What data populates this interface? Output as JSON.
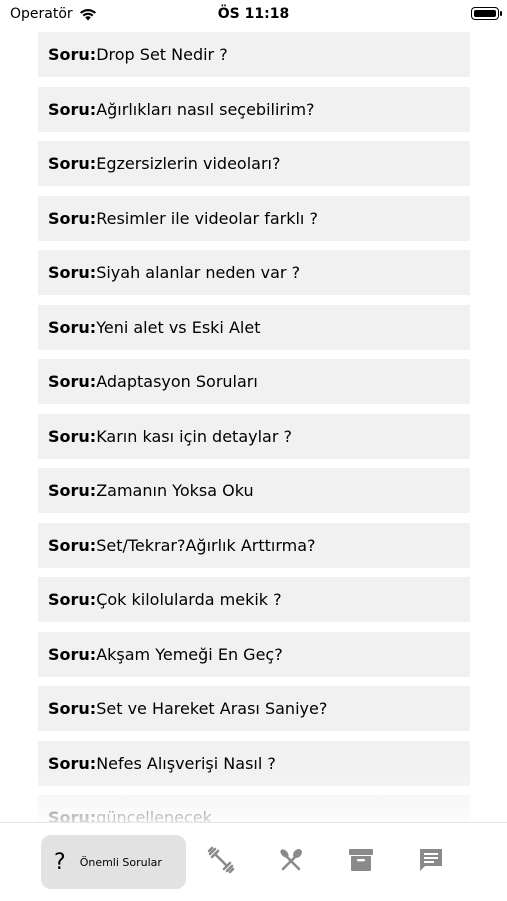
{
  "status_bar": {
    "carrier": "Operatör",
    "time": "ÖS 11:18"
  },
  "questions": [
    {
      "prefix": "Soru:",
      "text": " Drop Set Nedir ?"
    },
    {
      "prefix": "Soru:",
      "text": " Ağırlıkları nasıl seçebilirim?"
    },
    {
      "prefix": "Soru:",
      "text": " Egzersizlerin videoları?"
    },
    {
      "prefix": "Soru:",
      "text": " Resimler ile videolar farklı ?"
    },
    {
      "prefix": "Soru:",
      "text": " Siyah alanlar neden var ?"
    },
    {
      "prefix": "Soru:",
      "text": " Yeni alet vs Eski Alet"
    },
    {
      "prefix": "Soru:",
      "text": "Adaptasyon Soruları"
    },
    {
      "prefix": "Soru:",
      "text": "Karın kası için detaylar ?"
    },
    {
      "prefix": "Soru:",
      "text": "Zamanın Yoksa Oku"
    },
    {
      "prefix": "Soru:",
      "text": "Set/Tekrar?Ağırlık Arttırma?"
    },
    {
      "prefix": "Soru:",
      "text": "Çok kilolularda mekik ?"
    },
    {
      "prefix": "Soru:",
      "text": "Akşam Yemeği En Geç?"
    },
    {
      "prefix": "Soru:",
      "text": "Set ve Hareket Arası Saniye?"
    },
    {
      "prefix": "Soru:",
      "text": " Nefes Alışverişi Nasıl ?"
    },
    {
      "prefix": "Soru:",
      "text": " güncellenecek"
    }
  ],
  "tab_bar": {
    "active_icon": "?",
    "active_label": "Önemli Sorular",
    "icons": [
      "dumbbell-icon",
      "fork-knife-icon",
      "archive-icon",
      "chat-icon"
    ]
  }
}
